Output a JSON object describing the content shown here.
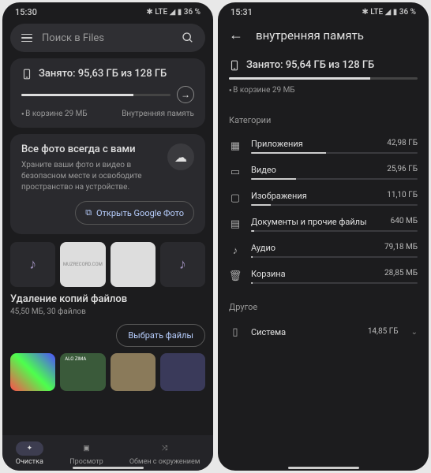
{
  "left": {
    "status": {
      "time": "15:30",
      "right": "✱ LTE ◢ ▮ 36 %"
    },
    "search_placeholder": "Поиск в Files",
    "storage": {
      "title": "Занято: 95,63 ГБ из 128 ГБ",
      "fill_pct": 75,
      "trash": "В корзине 29 МБ",
      "location": "Внутренняя память"
    },
    "promo": {
      "title": "Все фото всегда с вами",
      "text": "Храните ваши фото и видео в безопасном месте и освободите пространство на устройстве.",
      "button": "Открыть Google Фото"
    },
    "duplicates": {
      "title": "Удаление копий файлов",
      "sub": "45,50 МБ, 30 файлов",
      "button": "Выбрать файлы"
    },
    "nav": {
      "clean": "Очистка",
      "browse": "Просмотр",
      "share": "Обмен с окружением"
    }
  },
  "right": {
    "status": {
      "time": "15:31",
      "right": "✱ LTE ◢ ▮ 36 %"
    },
    "title": "внутренняя память",
    "storage": {
      "title": "Занято: 95,64 ГБ из 128 ГБ",
      "fill_pct": 75,
      "trash": "В корзине 29 МБ"
    },
    "section_categories": "Категории",
    "categories": [
      {
        "icon": "apps",
        "label": "Приложения",
        "size": "42,98 ГБ",
        "pct": 45
      },
      {
        "icon": "video",
        "label": "Видео",
        "size": "25,96 ГБ",
        "pct": 27
      },
      {
        "icon": "image",
        "label": "Изображения",
        "size": "11,10 ГБ",
        "pct": 12
      },
      {
        "icon": "doc",
        "label": "Документы и прочие файлы",
        "size": "640 МБ",
        "pct": 2
      },
      {
        "icon": "audio",
        "label": "Аудио",
        "size": "79,18 МБ",
        "pct": 1
      },
      {
        "icon": "trash",
        "label": "Корзина",
        "size": "28,85 МБ",
        "pct": 1
      }
    ],
    "section_other": "Другое",
    "other": [
      {
        "icon": "system",
        "label": "Система",
        "size": "14,85 ГБ",
        "chevron": true
      }
    ]
  }
}
